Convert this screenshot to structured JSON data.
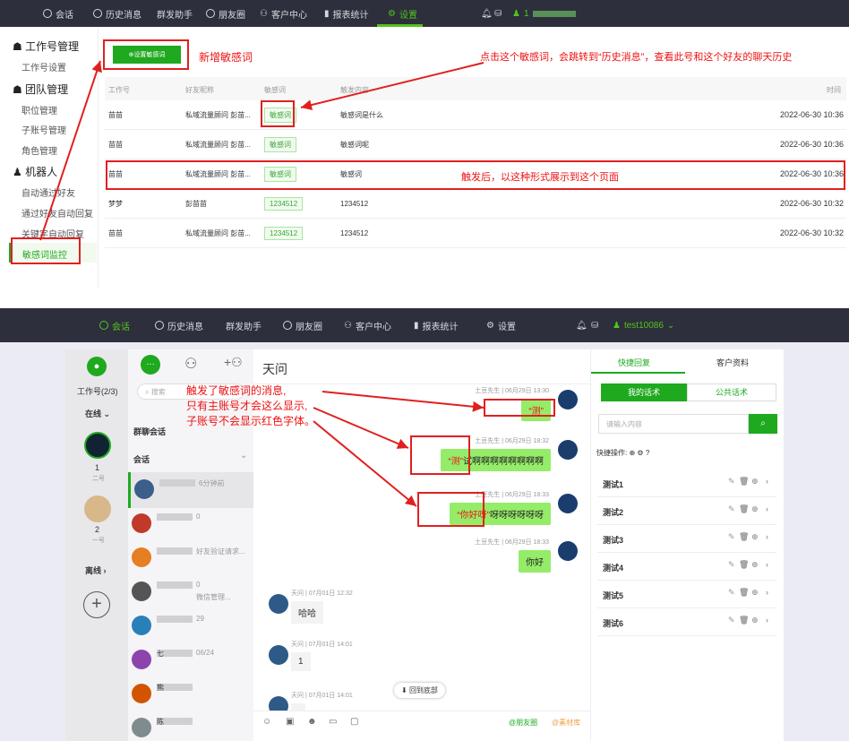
{
  "top": {
    "nav": {
      "chat": "会话",
      "history": "历史消息",
      "mass": "群发助手",
      "moments": "朋友圈",
      "customer": "客户中心",
      "report": "报表统计",
      "settings": "设置",
      "user": "1"
    },
    "sidebar": {
      "g1": "工作号管理",
      "g1_items": [
        "工作号设置"
      ],
      "g2": "团队管理",
      "g2_items": [
        "职位管理",
        "子账号管理",
        "角色管理"
      ],
      "g3": "机器人",
      "g3_items": [
        "自动通过好友",
        "通过好友自动回复",
        "关键字自动回复",
        "敏感词监控"
      ]
    },
    "add_button": "设置敏感词",
    "note_add": "新增敏感词",
    "note_click": "点击这个敏感词，会跳转到“历史消息”，查看此号和这个好友的聊天历史",
    "note_trigger": "触发后，以这种形式展示到这个页面",
    "headers": [
      "工作号",
      "好友昵称",
      "敏感词",
      "触发内容",
      "时间"
    ],
    "rows": [
      {
        "account": "苗苗",
        "friend": "私域流量顾问 彭苗...",
        "word": "敏感词",
        "content": "敏感词是什么",
        "time": "2022-06-30 10:36"
      },
      {
        "account": "苗苗",
        "friend": "私域流量顾问 彭苗...",
        "word": "敏感词",
        "content": "敏感词呢",
        "time": "2022-06-30 10:36"
      },
      {
        "account": "苗苗",
        "friend": "私域流量顾问 彭苗...",
        "word": "敏感词",
        "content": "敏感词",
        "time": "2022-06-30 10:36"
      },
      {
        "account": "梦梦",
        "friend": "彭苗苗",
        "word": "1234512",
        "content": "1234512",
        "time": "2022-06-30 10:32"
      },
      {
        "account": "苗苗",
        "friend": "私域流量顾问 彭苗...",
        "word": "1234512",
        "content": "1234512",
        "time": "2022-06-30 10:32"
      }
    ]
  },
  "bottom": {
    "nav": {
      "chat": "会话",
      "history": "历史消息",
      "mass": "群发助手",
      "moments": "朋友圈",
      "customer": "客户中心",
      "report": "报表统计",
      "settings": "设置",
      "user": "test10086"
    },
    "left": {
      "work": "工作号(2/3)",
      "online": "在线",
      "acc1_num": "1",
      "acc1_label": "二号",
      "acc2_num": "2",
      "acc2_label": "一号",
      "offline": "离线"
    },
    "search_placeholder": "搜索",
    "group_chat": "群聊会话",
    "chats_label": "会话",
    "chat_list": [
      {
        "title": "",
        "sub": "6分钟前"
      },
      {
        "title": "",
        "sub": "0"
      },
      {
        "title": "",
        "sub": "好友验证请求..."
      },
      {
        "title": "",
        "sub": "0",
        "sub2": "微信管理..."
      },
      {
        "title": "",
        "sub": "29"
      },
      {
        "title": "七",
        "sub": "06/24"
      },
      {
        "title": "熊",
        "sub": ""
      },
      {
        "title": "陈",
        "sub": ""
      }
    ],
    "chat_title": "天问",
    "annotation": [
      "触发了敏感词的消息,",
      "只有主账号才会这么显示,",
      "子账号不会显示红色字体。"
    ],
    "messages": [
      {
        "meta": "土豆先生 | 06月29日 13:30",
        "red": "“测”",
        "rest": ""
      },
      {
        "meta": "土豆先生 | 06月29日 18:32",
        "red": "“测”",
        "rest": "试啊啊啊啊啊啊啊啊"
      },
      {
        "meta": "土豆先生 | 06月29日 18:33",
        "red": "“你好呀”",
        "rest": "呀呀呀呀呀呀"
      },
      {
        "meta": "土豆先生 | 06月29日 18:33",
        "red": "",
        "rest": "你好"
      }
    ],
    "in_messages": [
      {
        "meta": "天问 | 07月01日 12:32",
        "text": "哈哈"
      },
      {
        "meta": "天问 | 07月01日 14:01",
        "text": "1"
      },
      {
        "meta": "天问 | 07月01日 14:01",
        "text": ""
      }
    ],
    "back_bottom": "回到底部",
    "toolbar_right": {
      "moments": "@朋友圈",
      "material": "@素材库"
    },
    "right": {
      "tab1": "快捷回复",
      "tab2": "客户资料",
      "sub1": "我的话术",
      "sub2": "公共话术",
      "input_placeholder": "请输入内容",
      "ops": "快捷操作:",
      "items": [
        "测试1",
        "测试2",
        "测试3",
        "测试4",
        "测试5",
        "测试6"
      ]
    }
  },
  "colors": {
    "nav": "#2d2f3c",
    "green": "#1ea91e",
    "red": "#e02020",
    "bubble": "#95ec69"
  }
}
